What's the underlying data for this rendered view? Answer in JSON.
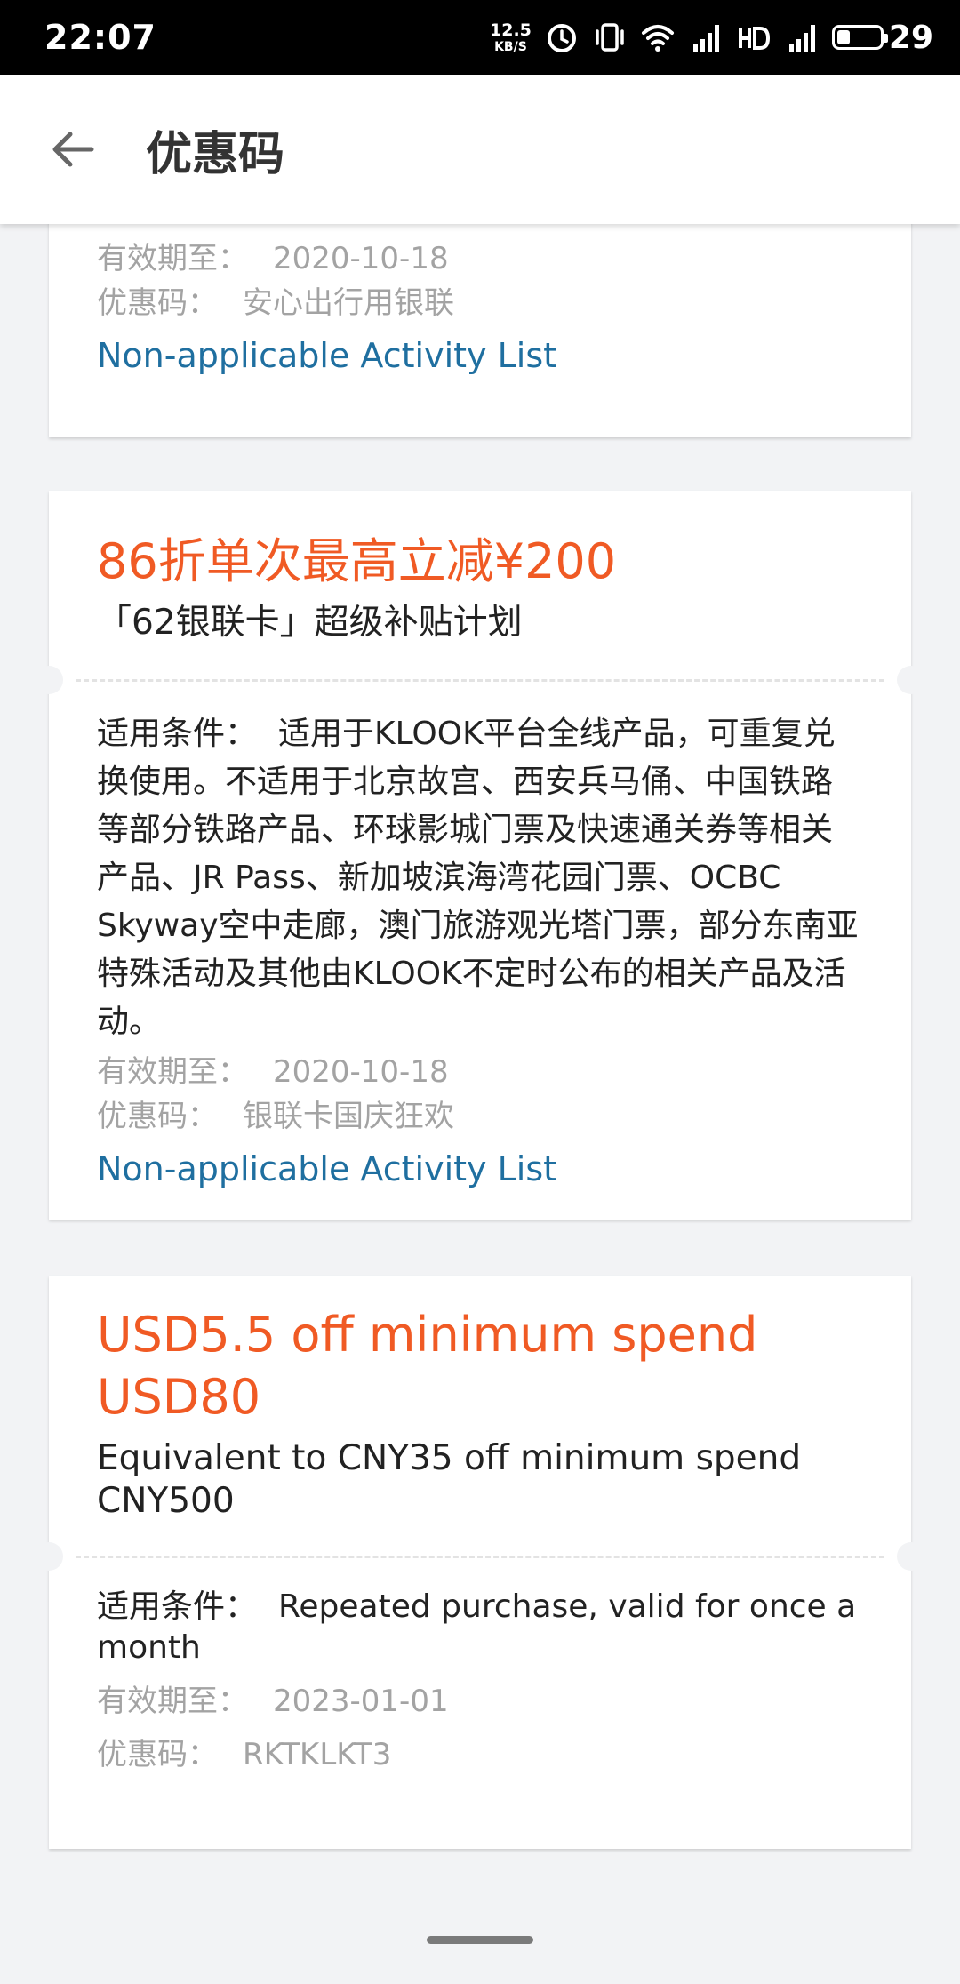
{
  "status_bar": {
    "time": "22:07",
    "net_speed_value": "12.5",
    "net_speed_unit": "KB/S",
    "battery_level": "29"
  },
  "app_bar": {
    "title": "优惠码"
  },
  "coupons": [
    {
      "validity_label": "有效期至：",
      "validity_value": "2020-10-18",
      "code_label": "优惠码：",
      "code_value": "安心出行用银联",
      "link": "Non-applicable Activity List"
    },
    {
      "title": "86折单次最高立减¥200",
      "subtitle": "「62银联卡」超级补贴计划",
      "condition_label": "适用条件：",
      "condition_text": "适用于KLOOK平台全线产品，可重复兑换使用。不适用于北京故宫、西安兵马俑、中国铁路等部分铁路产品、环球影城门票及快速通关券等相关产品、JR Pass、新加坡滨海湾花园门票、OCBC Skyway空中走廊，澳门旅游观光塔门票，部分东南亚特殊活动及其他由KLOOK不定时公布的相关产品及活动。",
      "validity_label": "有效期至：",
      "validity_value": "2020-10-18",
      "code_label": "优惠码：",
      "code_value": "银联卡国庆狂欢",
      "link": "Non-applicable Activity List"
    },
    {
      "title": "USD5.5 off minimum spend USD80",
      "subtitle": "Equivalent to CNY35 off minimum spend CNY500",
      "condition_label": "适用条件：",
      "condition_text": "Repeated purchase, valid for once a month",
      "validity_label": "有效期至：",
      "validity_value": "2023-01-01",
      "code_label": "优惠码：",
      "code_value": "RKTKLKT3"
    }
  ],
  "colors": {
    "title": "#f05a24",
    "link": "#1f6fa0",
    "meta": "#a3a3a3",
    "background": "#f2f3f5"
  }
}
